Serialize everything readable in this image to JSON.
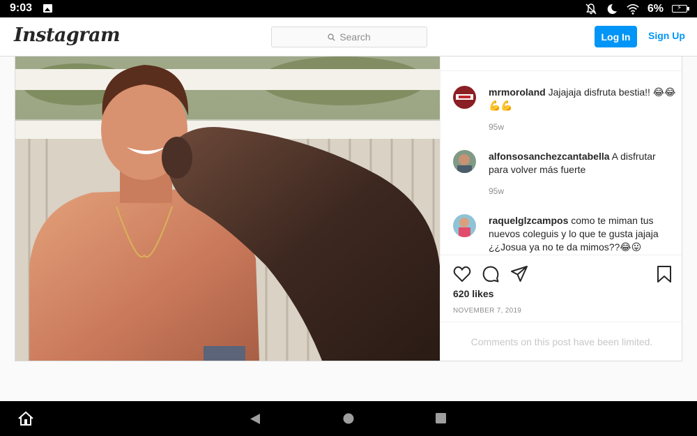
{
  "status_bar": {
    "time": "9:03",
    "battery": "6%",
    "icons": [
      "gallery-icon",
      "notifications-off-icon",
      "do-not-disturb-icon",
      "wifi-icon",
      "battery-charging-icon"
    ]
  },
  "header": {
    "logo": "Instagram",
    "search_placeholder": "Search",
    "login_label": "Log In",
    "signup_label": "Sign Up"
  },
  "comments": [
    {
      "user": "mrmoroland",
      "text": "Jajajaja disfruta bestia!! 😂😂💪💪",
      "time": "95w"
    },
    {
      "user": "alfonsosanchezcantabella",
      "text": "A disfrutar para volver más fuerte",
      "time": "95w"
    },
    {
      "user": "raquelglzcampos",
      "text": "como te miman tus nuevos coleguis y lo que te gusta jajaja ¿¿Josua ya no te da mimos??😂😛"
    }
  ],
  "post": {
    "likes": "620 likes",
    "date": "NOVEMBER 7, 2019",
    "comments_limited": "Comments on this post have been limited."
  },
  "colors": {
    "accent": "#0095f6",
    "text": "#262626",
    "muted": "#8e8e8e",
    "border": "#dbdbdb"
  }
}
